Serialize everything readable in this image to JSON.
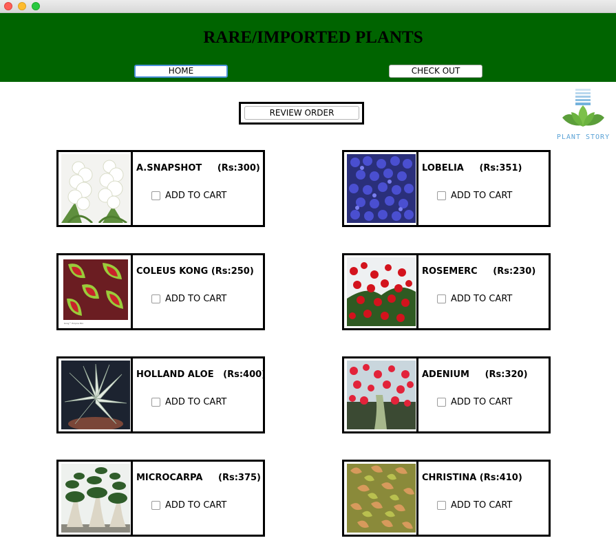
{
  "window": {
    "buttons": [
      "close",
      "minimize",
      "zoom"
    ]
  },
  "header": {
    "title": "RARE/IMPORTED PLANTS",
    "home_label": "HOME",
    "checkout_label": "CHECK OUT",
    "background": "#006400"
  },
  "review": {
    "label": "REVIEW ORDER"
  },
  "logo": {
    "text": "PLANT STORY",
    "icon": "lotus-icon"
  },
  "products": [
    {
      "name": "A.SNAPSHOT     (Rs:300)",
      "cart_label": "ADD TO CART",
      "checked": false,
      "image": "white-snapdragon"
    },
    {
      "name": "LOBELIA     (Rs:351)",
      "cart_label": "ADD TO CART",
      "checked": false,
      "image": "blue-lobelia"
    },
    {
      "name": "COLEUS KONG (Rs:250)",
      "cart_label": "ADD TO CART",
      "checked": false,
      "image": "coleus-leaves"
    },
    {
      "name": "ROSEMERC     (Rs:230)",
      "cart_label": "ADD TO CART",
      "checked": false,
      "image": "red-roses"
    },
    {
      "name": "HOLLAND ALOE   (Rs:400)",
      "cart_label": "ADD TO CART",
      "checked": false,
      "image": "white-aloe"
    },
    {
      "name": "ADENIUM     (Rs:320)",
      "cart_label": "ADD TO CART",
      "checked": false,
      "image": "red-adenium"
    },
    {
      "name": "MICROCARPA     (Rs:375)",
      "cart_label": "ADD TO CART",
      "checked": false,
      "image": "bonsai-trees"
    },
    {
      "name": "CHRISTINA (Rs:410)",
      "cart_label": "ADD TO CART",
      "checked": false,
      "image": "christina-shrub"
    }
  ]
}
